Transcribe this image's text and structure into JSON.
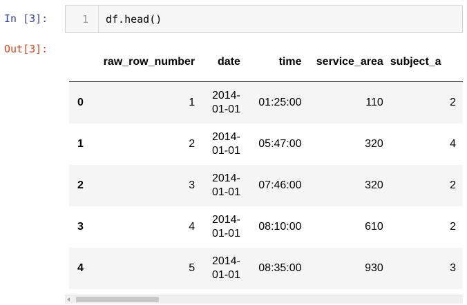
{
  "input": {
    "prompt": "In [3]:",
    "line_number": "1",
    "code": "df.head()"
  },
  "output": {
    "prompt": "Out[3]:"
  },
  "dataframe": {
    "columns": [
      "raw_row_number",
      "date",
      "time",
      "service_area",
      "subject_a"
    ],
    "rows": [
      {
        "index": "0",
        "raw_row_number": "1",
        "date_line1": "2014-",
        "date_line2": "01-01",
        "time": "01:25:00",
        "service_area": "110",
        "subject_a": "2"
      },
      {
        "index": "1",
        "raw_row_number": "2",
        "date_line1": "2014-",
        "date_line2": "01-01",
        "time": "05:47:00",
        "service_area": "320",
        "subject_a": "4"
      },
      {
        "index": "2",
        "raw_row_number": "3",
        "date_line1": "2014-",
        "date_line2": "01-01",
        "time": "07:46:00",
        "service_area": "320",
        "subject_a": "2"
      },
      {
        "index": "3",
        "raw_row_number": "4",
        "date_line1": "2014-",
        "date_line2": "01-01",
        "time": "08:10:00",
        "service_area": "610",
        "subject_a": "2"
      },
      {
        "index": "4",
        "raw_row_number": "5",
        "date_line1": "2014-",
        "date_line2": "01-01",
        "time": "08:35:00",
        "service_area": "930",
        "subject_a": "3"
      }
    ]
  },
  "colors": {
    "in_prompt": "#303f9f",
    "out_prompt": "#d84315",
    "row_stripe": "#f5f5f5"
  },
  "scrollbar": {
    "position_fraction": 0.0
  }
}
